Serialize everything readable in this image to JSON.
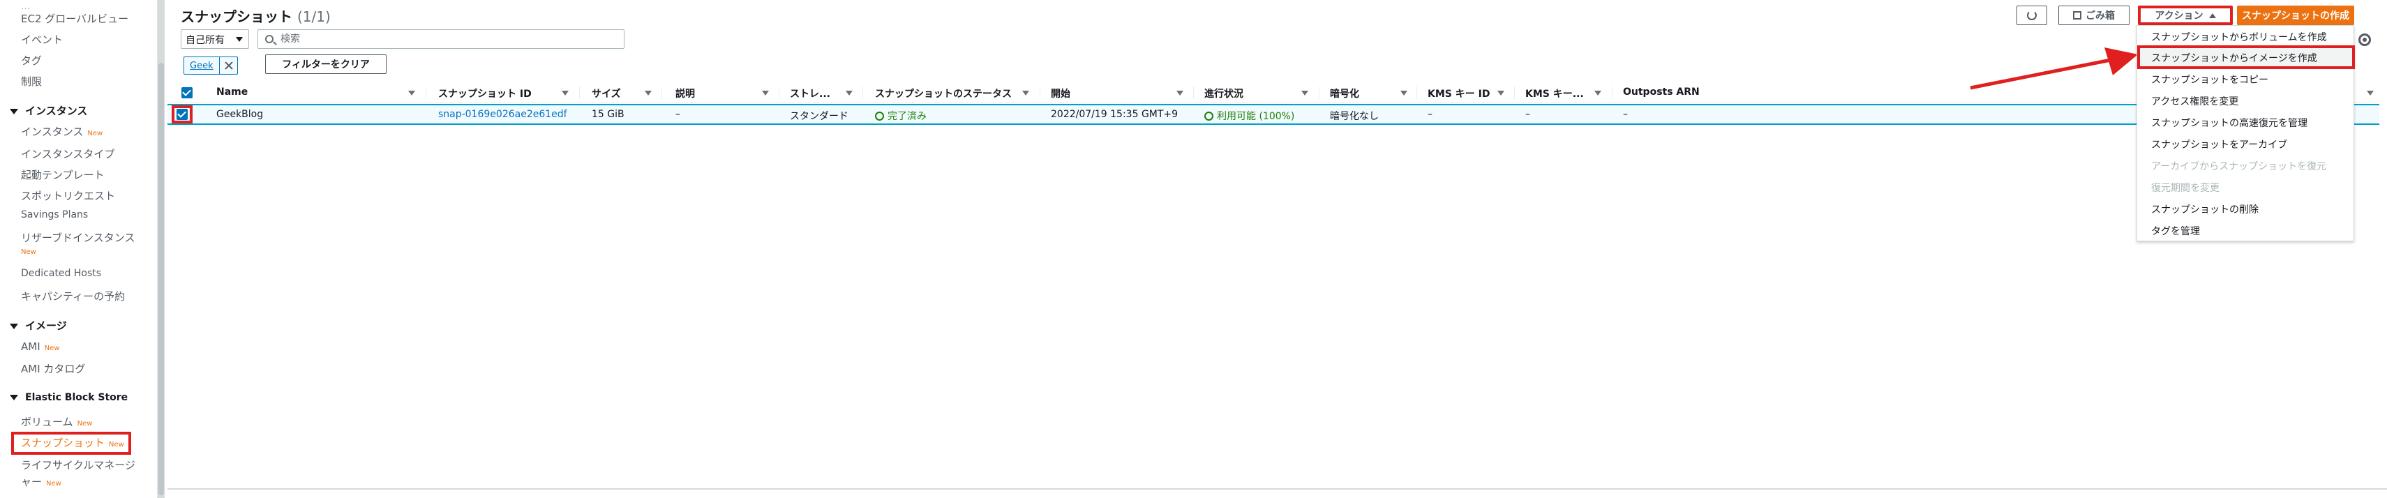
{
  "sidebar": {
    "top_items": [
      {
        "label": "EC2 グローバルビュー"
      },
      {
        "label": "イベント"
      },
      {
        "label": "タグ"
      },
      {
        "label": "制限"
      }
    ],
    "sections": [
      {
        "title": "インスタンス",
        "items": [
          {
            "label": "インスタンス",
            "badge": "New"
          },
          {
            "label": "インスタンスタイプ"
          },
          {
            "label": "起動テンプレート"
          },
          {
            "label": "スポットリクエスト"
          },
          {
            "label": "Savings Plans"
          },
          {
            "label": "リザーブドインスタンス"
          },
          {
            "label": "",
            "badge": "New"
          },
          {
            "label": "Dedicated Hosts"
          },
          {
            "label": "キャパシティーの予約"
          }
        ]
      },
      {
        "title": "イメージ",
        "items": [
          {
            "label": "AMI",
            "badge": "New"
          },
          {
            "label": "AMI カタログ"
          }
        ]
      },
      {
        "title": "Elastic Block Store",
        "items": [
          {
            "label": "ボリューム",
            "badge": "New"
          },
          {
            "label": "スナップショット",
            "badge": "New"
          },
          {
            "label": "ライフサイクルマネージ"
          },
          {
            "label": "ャー",
            "badge": "New"
          }
        ]
      }
    ]
  },
  "header": {
    "title": "スナップショット",
    "count": "(1/1)",
    "refresh_icon": "refresh-icon",
    "recycle_label": "ごみ箱",
    "actions_label": "アクション",
    "create_label": "スナップショットの作成"
  },
  "filter": {
    "owner_value": "自己所有",
    "search_placeholder": "検索",
    "token": "Geek",
    "clear_label": "フィルターをクリア"
  },
  "table": {
    "columns": [
      "Name",
      "スナップショット ID",
      "サイズ",
      "説明",
      "ストレ...",
      "スナップショットのステータス",
      "開始",
      "進行状況",
      "暗号化",
      "KMS キー ID",
      "KMS キー...",
      "Outposts ARN"
    ],
    "row": {
      "name": "GeekBlog",
      "snapshot_id": "snap-0169e026ae2e61edf",
      "size": "15 GiB",
      "description": "–",
      "storage": "スタンダード",
      "status": "完了済み",
      "started": "2022/07/19 15:35 GMT+9",
      "progress": "利用可能 (100%)",
      "encryption": "暗号化なし",
      "kms_id": "–",
      "kms_alias": "–",
      "outposts": "–"
    }
  },
  "actions_menu": {
    "items": [
      {
        "label": "スナップショットからボリュームを作成",
        "disabled": false
      },
      {
        "label": "スナップショットからイメージを作成",
        "disabled": false
      },
      {
        "label": "スナップショットをコピー",
        "disabled": false
      },
      {
        "label": "アクセス権限を変更",
        "disabled": false
      },
      {
        "label": "スナップショットの高速復元を管理",
        "disabled": false
      },
      {
        "label": "スナップショットをアーカイブ",
        "disabled": false
      },
      {
        "label": "アーカイブからスナップショットを復元",
        "disabled": true
      },
      {
        "label": "復元期間を変更",
        "disabled": true
      },
      {
        "label": "スナップショットの削除",
        "disabled": false
      },
      {
        "label": "タグを管理",
        "disabled": false
      }
    ]
  },
  "colors": {
    "accent": "#ec7211",
    "link": "#0073bb",
    "success": "#1d8102",
    "annotation": "#e0201e"
  }
}
